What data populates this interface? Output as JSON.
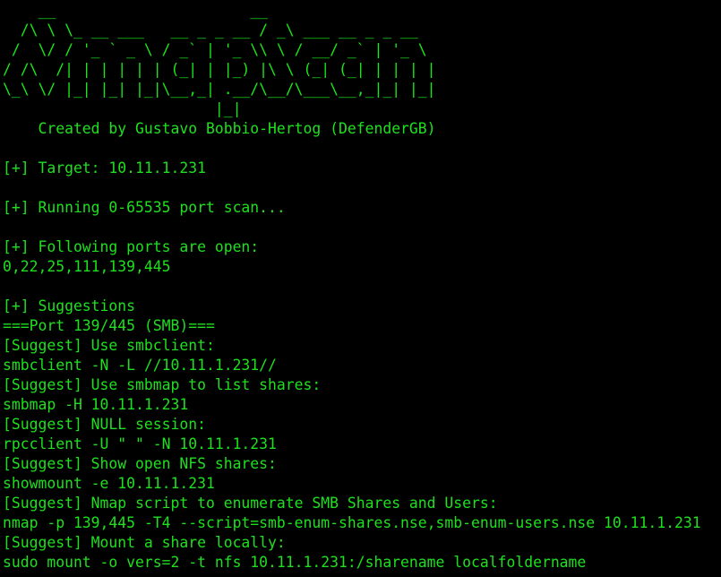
{
  "terminal": {
    "banner": [
      "    __                      __",
      "  /\\ \\ \\_ __ ___   __ _ _ __ / _\\ ___ __ _ _ __",
      " /  \\/ / '_ ` _ \\ / _` | '_ \\\\ \\ / __/ _` | '_ \\",
      "/ /\\  /| | | | | | (_| | |_) |\\ \\ (_| (_| | | | |",
      "\\_\\ \\/ |_| |_| |_|\\__,_| .__/\\__/\\___\\__,_|_| |_|",
      "                        |_|",
      "    Created by Gustavo Bobbio-Hertog (DefenderGB)"
    ],
    "output": [
      "",
      "[+] Target: 10.11.1.231",
      "",
      "[+] Running 0-65535 port scan...",
      "",
      "[+] Following ports are open:",
      "0,22,25,111,139,445",
      "",
      "[+] Suggestions",
      "===Port 139/445 (SMB)===",
      "[Suggest] Use smbclient:",
      "smbclient -N -L //10.11.1.231//",
      "[Suggest] Use smbmap to list shares:",
      "smbmap -H 10.11.1.231",
      "[Suggest] NULL session:",
      "rpcclient -U \" \" -N 10.11.1.231",
      "[Suggest] Show open NFS shares:",
      "showmount -e 10.11.1.231",
      "[Suggest] Nmap script to enumerate SMB Shares and Users:",
      "nmap -p 139,445 -T4 --script=smb-enum-shares.nse,smb-enum-users.nse 10.11.1.231",
      "[Suggest] Mount a share locally:",
      "sudo mount -o vers=2 -t nfs 10.11.1.231:/sharename localfoldername"
    ]
  }
}
